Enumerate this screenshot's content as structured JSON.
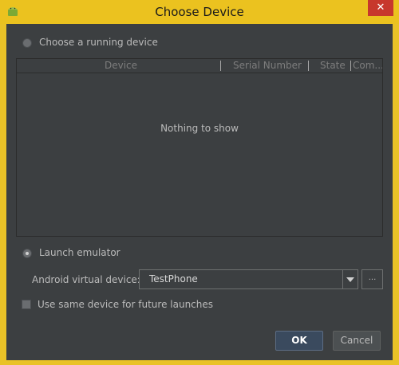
{
  "window": {
    "title": "Choose Device",
    "close_glyph": "✕",
    "app_icon": "android-icon"
  },
  "running_device": {
    "radio_label": "Choose a running device",
    "columns": [
      "Device",
      "Serial Number",
      "State",
      "Com..."
    ],
    "empty_text": "Nothing to show"
  },
  "emulator": {
    "radio_label": "Launch emulator",
    "avd_label": "Android virtual device:",
    "avd_value": "TestPhone",
    "browse_label": "..."
  },
  "same_device_label": "Use same device for future launches",
  "buttons": {
    "ok": "OK",
    "cancel": "Cancel"
  },
  "colors": {
    "frame": "#ebc21f",
    "panel": "#3c3f41",
    "close": "#c7372c"
  }
}
